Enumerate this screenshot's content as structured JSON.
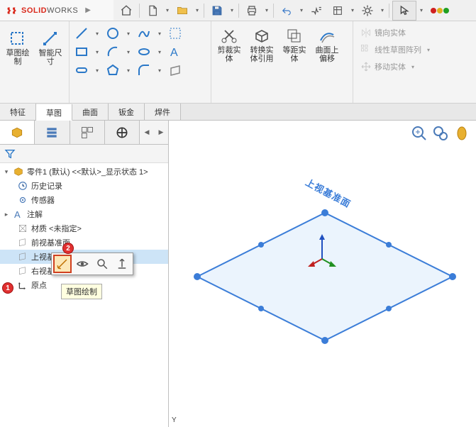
{
  "app": {
    "brand_bold": "SOLID",
    "brand_rest": "WORKS"
  },
  "qat": {
    "arrow_glyph": "▲"
  },
  "ribbon": {
    "group1": {
      "sketch": "草图绘\n制",
      "smartdim": "智能尺\n寸"
    },
    "group3": {
      "trim": "剪裁实\n体",
      "convert": "转换实\n体引用",
      "offset": "等距实\n体",
      "curve_offset": "曲面上\n偏移"
    },
    "side": {
      "mirror": "镜向实体",
      "pattern": "线性草图阵列",
      "move": "移动实体"
    }
  },
  "doctabs": [
    "特征",
    "草图",
    "曲面",
    "钣金",
    "焊件"
  ],
  "doctabs_active": 1,
  "tree": {
    "root": "零件1 (默认) <<默认>_显示状态 1>",
    "items": [
      {
        "label": "历史记录",
        "icon": "history"
      },
      {
        "label": "传感器",
        "icon": "sensor"
      },
      {
        "label": "注解",
        "icon": "annotation",
        "expandable": true
      },
      {
        "label": "材质 <未指定>",
        "icon": "material"
      },
      {
        "label": "前视基准面",
        "icon": "plane"
      },
      {
        "label": "上视基准面",
        "icon": "plane",
        "selected": true
      },
      {
        "label": "右视基准面",
        "icon": "plane"
      },
      {
        "label": "原点",
        "icon": "origin"
      }
    ]
  },
  "tooltip": "草图绘制",
  "callouts": {
    "c1": "1",
    "c2": "2"
  },
  "viewport": {
    "plane_label": "上视基准面",
    "axis_y": "Y"
  }
}
